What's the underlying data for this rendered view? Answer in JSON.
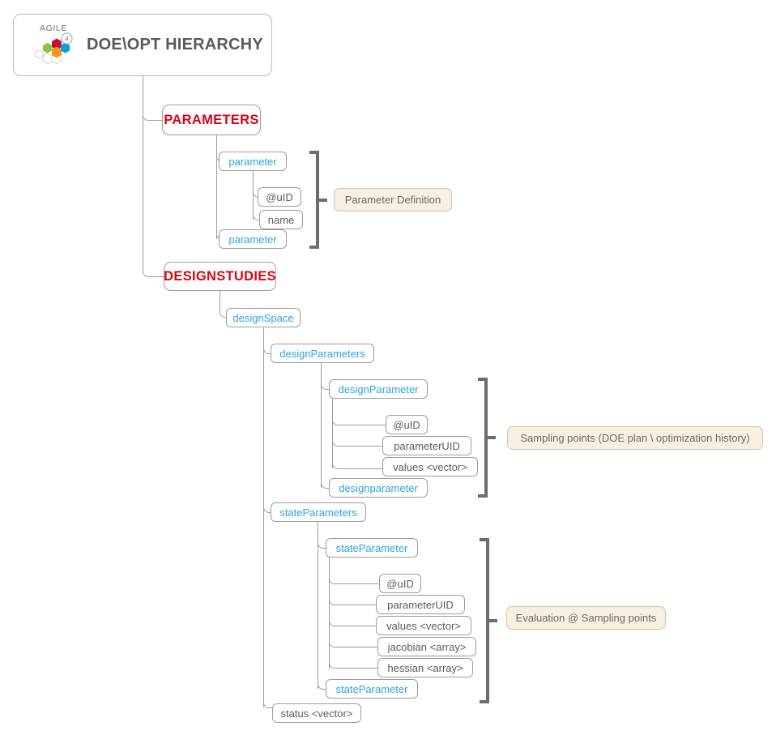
{
  "header": {
    "logo_word": "AGILE",
    "logo_badge": "4",
    "title": "DOE\\OPT HIERARCHY"
  },
  "colors": {
    "category_red": "#d40511",
    "element_blue": "#2ba6de",
    "leaf_gray": "#5c5c5c",
    "annotation_bg": "#f7efe1",
    "annotation_border": "#d5c5a9",
    "connector_gray": "#9d9d9d",
    "bracket_gray": "#6d6d6d",
    "title_gray": "#595a5c"
  },
  "tree": {
    "categories": [
      {
        "id": "parameters",
        "label": "PARAMETERS"
      },
      {
        "id": "designstudies",
        "label": "DESIGNSTUDIES"
      }
    ],
    "nodes": [
      {
        "id": "parameter-1",
        "label": "parameter",
        "kind": "element"
      },
      {
        "id": "parameter-uid",
        "label": "@uID",
        "kind": "leaf"
      },
      {
        "id": "parameter-name",
        "label": "name",
        "kind": "leaf"
      },
      {
        "id": "parameter-2",
        "label": "parameter",
        "kind": "element"
      },
      {
        "id": "designspace",
        "label": "designSpace",
        "kind": "element"
      },
      {
        "id": "designparameters",
        "label": "designParameters",
        "kind": "element"
      },
      {
        "id": "designparameter-1",
        "label": "designParameter",
        "kind": "element"
      },
      {
        "id": "dp-uid",
        "label": "@uID",
        "kind": "leaf"
      },
      {
        "id": "dp-parameteruid",
        "label": "parameterUID",
        "kind": "leaf"
      },
      {
        "id": "dp-values",
        "label": "values <vector>",
        "kind": "leaf"
      },
      {
        "id": "designparameter-2",
        "label": "designparameter",
        "kind": "element"
      },
      {
        "id": "stateparameters",
        "label": "stateParameters",
        "kind": "element"
      },
      {
        "id": "stateparameter-1",
        "label": "stateParameter",
        "kind": "element"
      },
      {
        "id": "sp-uid",
        "label": "@uID",
        "kind": "leaf"
      },
      {
        "id": "sp-parameteruid",
        "label": "parameterUID",
        "kind": "leaf"
      },
      {
        "id": "sp-values",
        "label": "values <vector>",
        "kind": "leaf"
      },
      {
        "id": "sp-jacobian",
        "label": "jacobian <array>",
        "kind": "leaf"
      },
      {
        "id": "sp-hessian",
        "label": "hessian <array>",
        "kind": "leaf"
      },
      {
        "id": "stateparameter-2",
        "label": "stateParameter",
        "kind": "element"
      },
      {
        "id": "status",
        "label": "status <vector>",
        "kind": "leaf"
      }
    ]
  },
  "annotations": [
    {
      "id": "anno-parameter-definition",
      "label": "Parameter Definition"
    },
    {
      "id": "anno-sampling-points",
      "label": "Sampling points (DOE plan \\ optimization history)"
    },
    {
      "id": "anno-evaluation",
      "label": "Evaluation @ Sampling points"
    }
  ]
}
